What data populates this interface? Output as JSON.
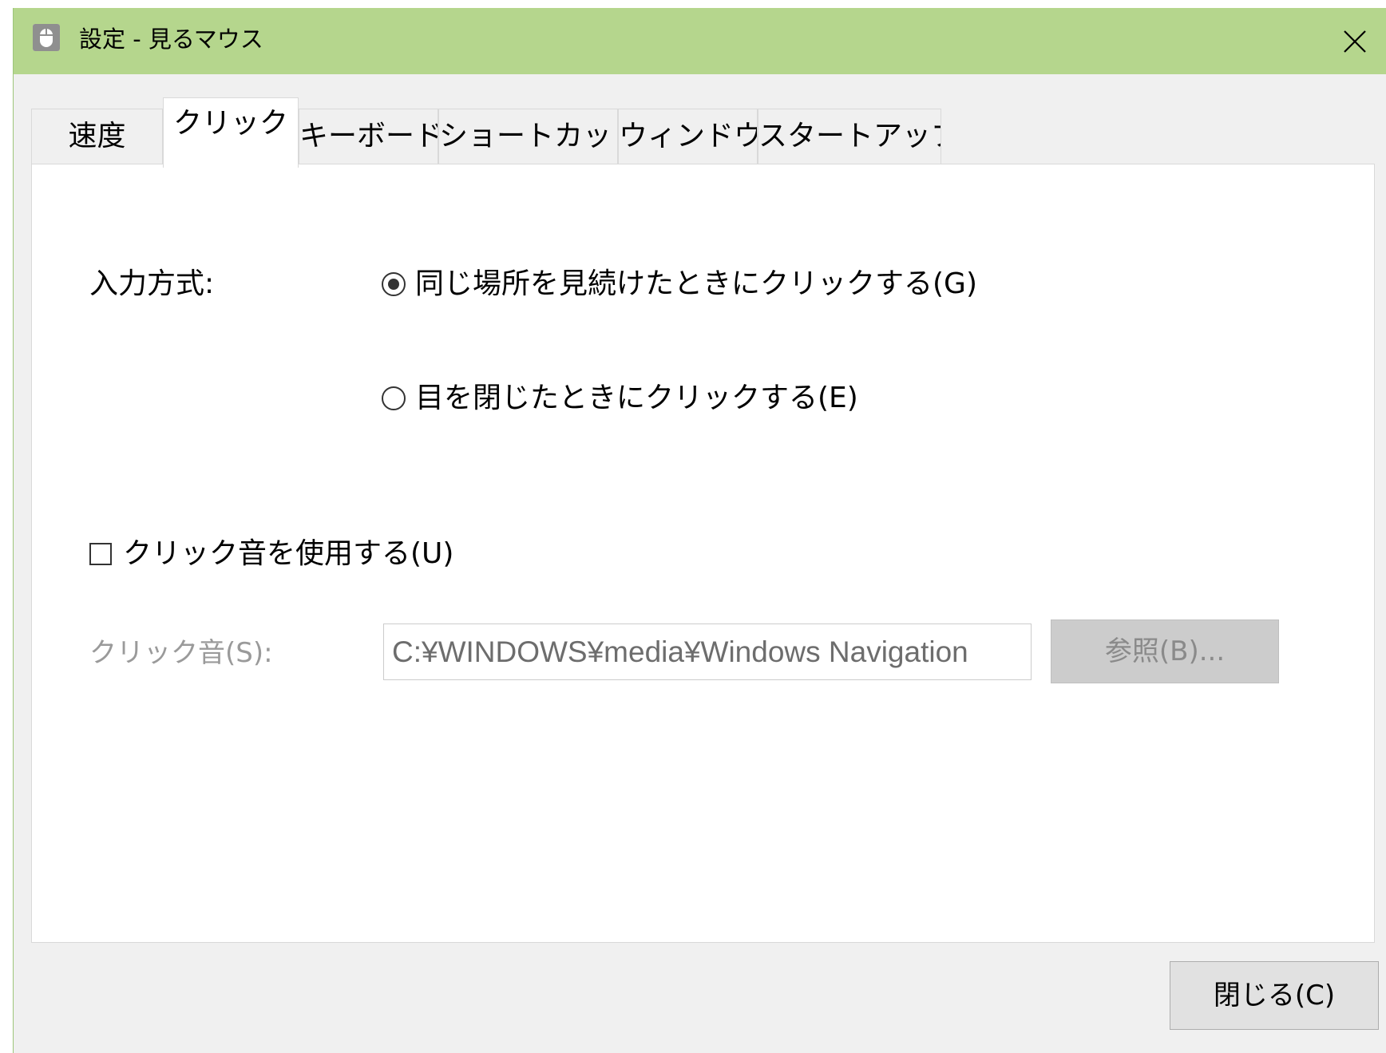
{
  "window": {
    "title": "設定 - 見るマウス",
    "icon": "mouse-icon",
    "close_icon": "close-icon",
    "titlebar_color": "#b5d68d"
  },
  "tabs": [
    {
      "label": "速度",
      "active": false
    },
    {
      "label": "クリック",
      "active": true
    },
    {
      "label": "キーボード",
      "active": false
    },
    {
      "label": "ショートカット",
      "active": false
    },
    {
      "label": "ウィンドウ",
      "active": false
    },
    {
      "label": "スタートアップ",
      "active": false
    }
  ],
  "click_tab": {
    "input_method_label": "入力方式:",
    "radio_gaze": {
      "label": "同じ場所を見続けたときにクリックする(G)",
      "checked": true
    },
    "radio_eyes": {
      "label": "目を閉じたときにクリックする(E)",
      "checked": false
    },
    "sound_checkbox": {
      "label": "クリック音を使用する(U)",
      "checked": false
    },
    "sound_label": "クリック音(S):",
    "sound_path": "C:¥WINDOWS¥media¥Windows Navigation",
    "browse_label": "参照(B)..."
  },
  "footer": {
    "close_label": "閉じる(C)"
  }
}
